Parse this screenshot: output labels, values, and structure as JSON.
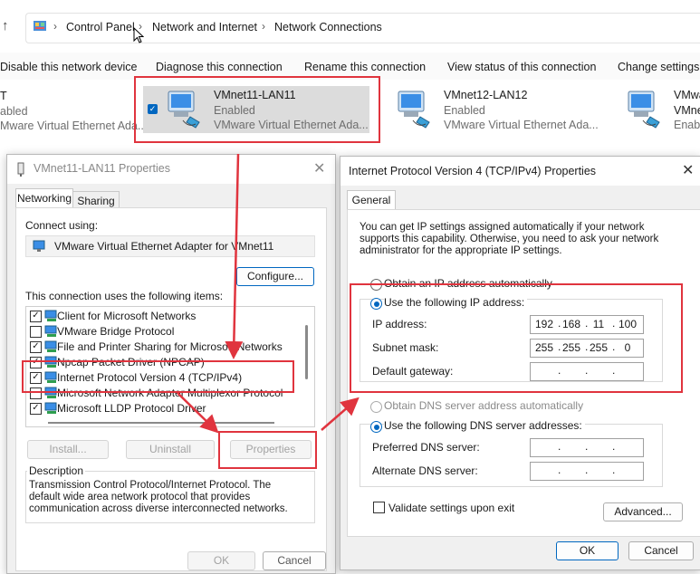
{
  "address": {
    "crumbs": [
      "Control Panel",
      "Network and Internet",
      "Network Connections"
    ],
    "separator": "›"
  },
  "commands": [
    "Disable this network device",
    "Diagnose this connection",
    "Rename this connection",
    "View status of this connection",
    "Change settings o"
  ],
  "adapters": [
    {
      "name": "T",
      "status": "abled",
      "device": "Mware Virtual Ethernet Ada..."
    },
    {
      "name": "VMnet11-LAN11",
      "status": "Enabled",
      "device": "VMware Virtual Ethernet Ada..."
    },
    {
      "name": "VMnet12-LAN12",
      "status": "Enabled",
      "device": "VMware Virtual Ethernet Ada..."
    },
    {
      "name": "VMwa",
      "status": "VMne",
      "device": "Enabl"
    }
  ],
  "props_dialog": {
    "title": "VMnet11-LAN11 Properties",
    "tabs": [
      "Networking",
      "Sharing"
    ],
    "connect_using_label": "Connect using:",
    "adapter": "VMware Virtual Ethernet Adapter for VMnet11",
    "configure_label": "Configure...",
    "items_label": "This connection uses the following items:",
    "items": [
      {
        "label": "Client for Microsoft Networks",
        "checked": true
      },
      {
        "label": "VMware Bridge Protocol",
        "checked": false
      },
      {
        "label": "File and Printer Sharing for Microsoft Networks",
        "checked": true
      },
      {
        "label": "Npcap Packet Driver (NPCAP)",
        "checked": true
      },
      {
        "label": "Internet Protocol Version 4 (TCP/IPv4)",
        "checked": true
      },
      {
        "label": "Microsoft Network Adapter Multiplexor Protocol",
        "checked": false
      },
      {
        "label": "Microsoft LLDP Protocol Driver",
        "checked": true
      }
    ],
    "install_label": "Install...",
    "uninstall_label": "Uninstall",
    "properties_label": "Properties",
    "description_title": "Description",
    "description_text": "Transmission Control Protocol/Internet Protocol. The default wide area network protocol that provides communication across diverse interconnected networks.",
    "ok_label": "OK",
    "cancel_label": "Cancel"
  },
  "ipv4_dialog": {
    "title": "Internet Protocol Version 4 (TCP/IPv4) Properties",
    "tab": "General",
    "intro": "You can get IP settings assigned automatically if your network supports this capability. Otherwise, you need to ask your network administrator for the appropriate IP settings.",
    "auto_ip_label": "Obtain an IP address automatically",
    "use_ip_label": "Use the following IP address:",
    "ip_label": "IP address:",
    "ip_value": [
      "192",
      "168",
      "11",
      "100"
    ],
    "mask_label": "Subnet mask:",
    "mask_value": [
      "255",
      "255",
      "255",
      "0"
    ],
    "gateway_label": "Default gateway:",
    "auto_dns_label": "Obtain DNS server address automatically",
    "use_dns_label": "Use the following DNS server addresses:",
    "pref_dns_label": "Preferred DNS server:",
    "alt_dns_label": "Alternate DNS server:",
    "validate_label": "Validate settings upon exit",
    "advanced_label": "Advanced...",
    "ok_label": "OK",
    "cancel_label": "Cancel"
  },
  "colors": {
    "annotation": "#e0343e",
    "accent": "#0067c0"
  }
}
